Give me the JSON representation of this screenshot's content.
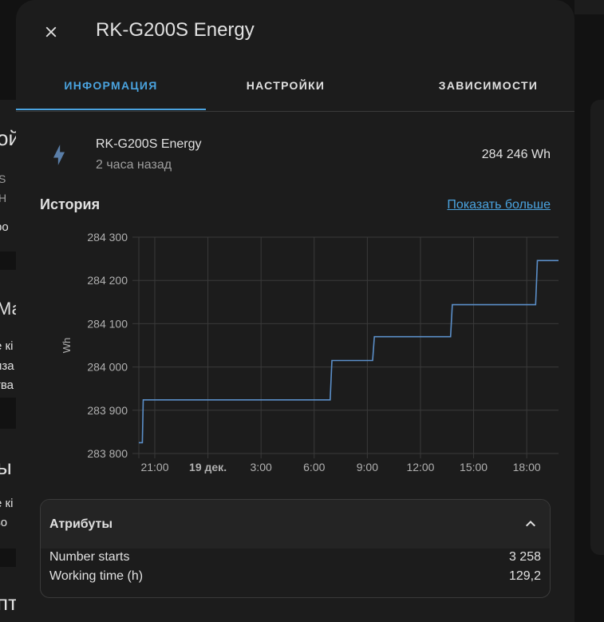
{
  "background": {
    "fragments": [
      "ой",
      "S",
      "Н",
      "ро",
      "Ма",
      "е кі",
      "иза",
      "тва",
      "ы",
      "е кі",
      "зо",
      "пт"
    ]
  },
  "dialog": {
    "title": "RK-G200S Energy",
    "close_icon": "close-icon",
    "tabs": [
      {
        "label": "ИНФОРМАЦИЯ",
        "active": true
      },
      {
        "label": "НАСТРОЙКИ",
        "active": false
      },
      {
        "label": "ЗАВИСИМОСТИ",
        "active": false
      }
    ]
  },
  "entity": {
    "icon": "lightning-bolt-icon",
    "name": "RK-G200S Energy",
    "last_changed": "2 часа назад",
    "state": "284 246 Wh"
  },
  "history": {
    "title": "История",
    "show_more": "Показать больше"
  },
  "chart_data": {
    "type": "line",
    "step": true,
    "ylabel": "Wh",
    "ylim": [
      283800,
      284300
    ],
    "y_ticks": [
      "283 800",
      "283 900",
      "284 000",
      "284 100",
      "284 200",
      "284 300"
    ],
    "x_ticks": [
      {
        "label": "21:00",
        "bold": false,
        "t": 21
      },
      {
        "label": "19 дек.",
        "bold": true,
        "t": 24
      },
      {
        "label": "3:00",
        "bold": false,
        "t": 27
      },
      {
        "label": "6:00",
        "bold": false,
        "t": 30
      },
      {
        "label": "9:00",
        "bold": false,
        "t": 33
      },
      {
        "label": "12:00",
        "bold": false,
        "t": 36
      },
      {
        "label": "15:00",
        "bold": false,
        "t": 39
      },
      {
        "label": "18:00",
        "bold": false,
        "t": 42
      }
    ],
    "xlim": [
      20.1,
      44.2
    ],
    "series": [
      {
        "color": "#5b8fc9",
        "points": [
          [
            20.1,
            283825
          ],
          [
            20.3,
            283825
          ],
          [
            20.35,
            283924
          ],
          [
            30.9,
            283924
          ],
          [
            31.0,
            284015
          ],
          [
            33.3,
            284015
          ],
          [
            33.4,
            284070
          ],
          [
            37.7,
            284070
          ],
          [
            37.8,
            284144
          ],
          [
            42.5,
            284144
          ],
          [
            42.6,
            284246
          ],
          [
            44.2,
            284246
          ]
        ]
      }
    ],
    "grid": true
  },
  "attributes": {
    "title": "Атрибуты",
    "chevron_icon": "chevron-up-icon",
    "rows": [
      {
        "name": "Number starts",
        "value": "3 258"
      },
      {
        "name": "Working time (h)",
        "value": "129,2"
      }
    ]
  },
  "colors": {
    "accent": "#4aa3df",
    "surface": "#1c1c1c",
    "background": "#121212",
    "text": "#e1e1e1",
    "muted": "#9e9e9e",
    "line": "#5b8fc9",
    "icon": "#5a7ea8"
  }
}
